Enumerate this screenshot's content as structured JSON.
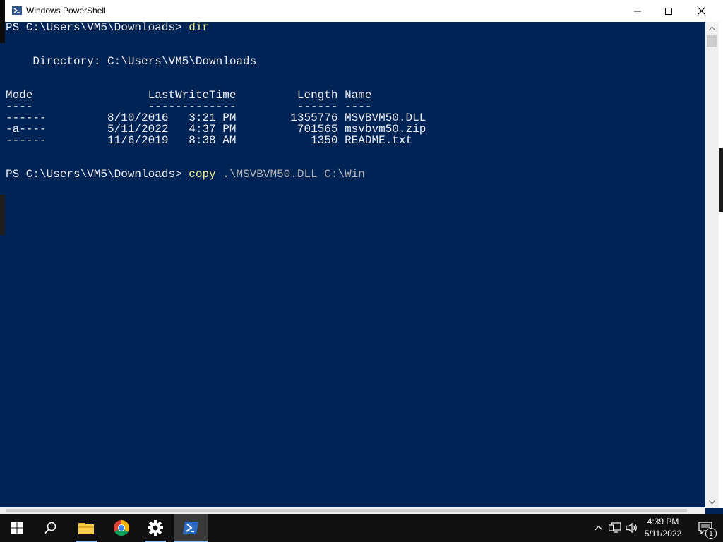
{
  "window": {
    "title": "Windows PowerShell",
    "icon": "powershell-icon",
    "controls": [
      "minimize-icon",
      "maximize-icon",
      "close-icon"
    ]
  },
  "console": {
    "background": "#012456",
    "foreground": "#eeedf0",
    "command_color": "#f3f08c",
    "lines": {
      "l1_prompt": "PS C:\\Users\\VM5\\Downloads> ",
      "l1_cmd": "dir",
      "l2_directory": "    Directory: C:\\Users\\VM5\\Downloads",
      "l3_header": "Mode                 LastWriteTime         Length Name",
      "l4_underline": "----                 -------------         ------ ----",
      "rows": [
        "------         8/10/2016   3:21 PM        1355776 MSVBVM50.DLL",
        "-a----         5/11/2022   4:37 PM         701565 msvbvm50.zip",
        "------         11/6/2019   8:38 AM           1350 README.txt"
      ],
      "l5_prompt": "PS C:\\Users\\VM5\\Downloads> ",
      "l5_cmd": "copy",
      "l5_args": " .\\MSVBVM50.DLL C:\\Win"
    }
  },
  "taskbar": {
    "items": [
      {
        "name": "start-icon"
      },
      {
        "name": "search-icon"
      },
      {
        "name": "file-explorer-icon"
      },
      {
        "name": "chrome-icon"
      },
      {
        "name": "settings-icon"
      },
      {
        "name": "powershell-icon",
        "active": true
      }
    ],
    "clock_time": "4:39 PM",
    "clock_date": "5/11/2022",
    "notification_count": "1"
  }
}
